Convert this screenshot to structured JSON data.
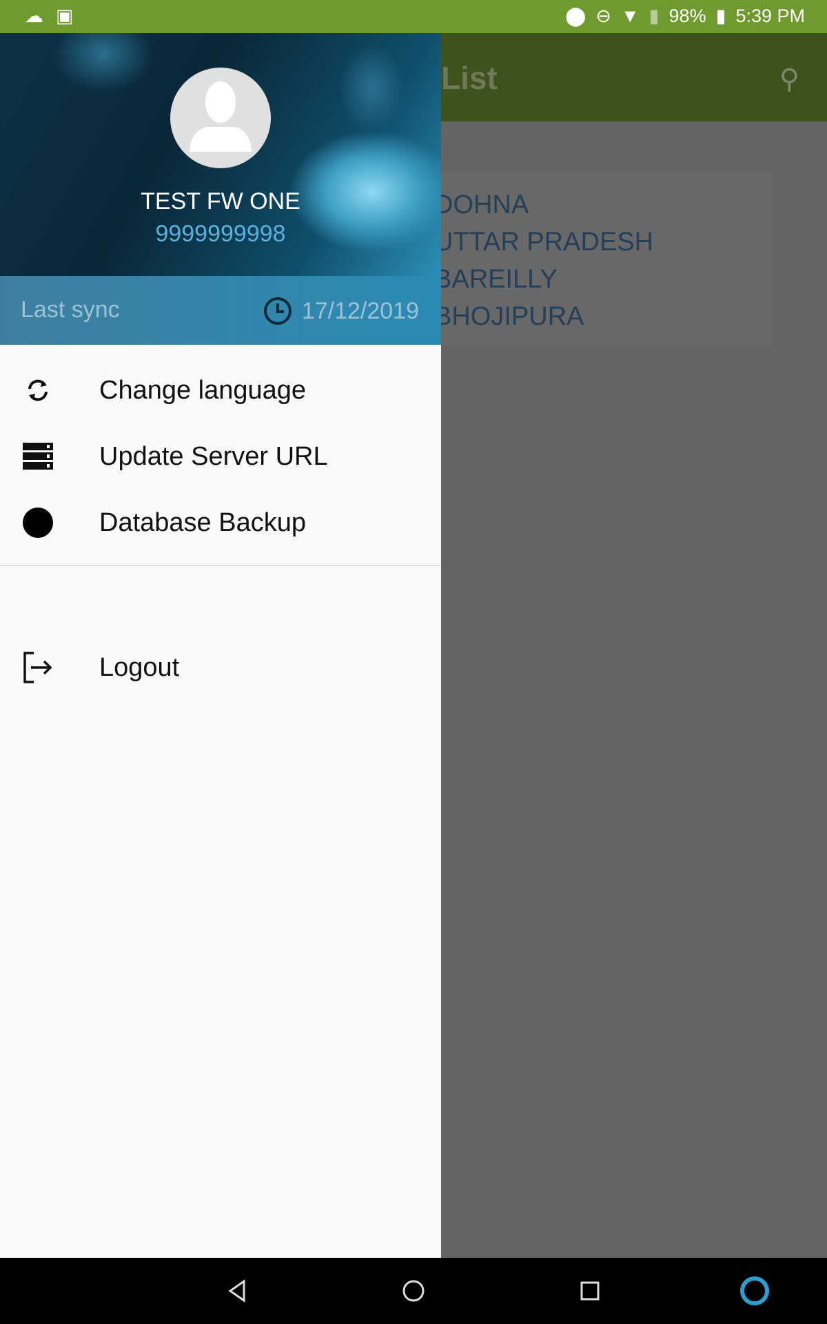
{
  "status_bar": {
    "battery": "98%",
    "time": "5:39 PM",
    "icons": [
      "weather-icon",
      "image-icon",
      "location-icon",
      "dnd-icon",
      "data-arrows-icon",
      "wifi-icon",
      "no-sim-icon",
      "battery-icon"
    ],
    "color": "#6f9a30"
  },
  "app": {
    "title": "List",
    "list": [
      "DOHNA",
      "UTTAR PRADESH",
      "BAREILLY",
      "BHOJIPURA"
    ]
  },
  "drawer": {
    "user_name": "TEST FW ONE",
    "phone": "9999999998",
    "last_sync_label": "Last sync",
    "last_sync_date": "17/12/2019",
    "items": [
      {
        "label": "Change language",
        "icon": "refresh-icon"
      },
      {
        "label": "Update Server URL",
        "icon": "server-icon"
      },
      {
        "label": "Database Backup",
        "icon": "circle-icon"
      }
    ],
    "logout": {
      "label": "Logout",
      "icon": "logout-icon"
    }
  }
}
